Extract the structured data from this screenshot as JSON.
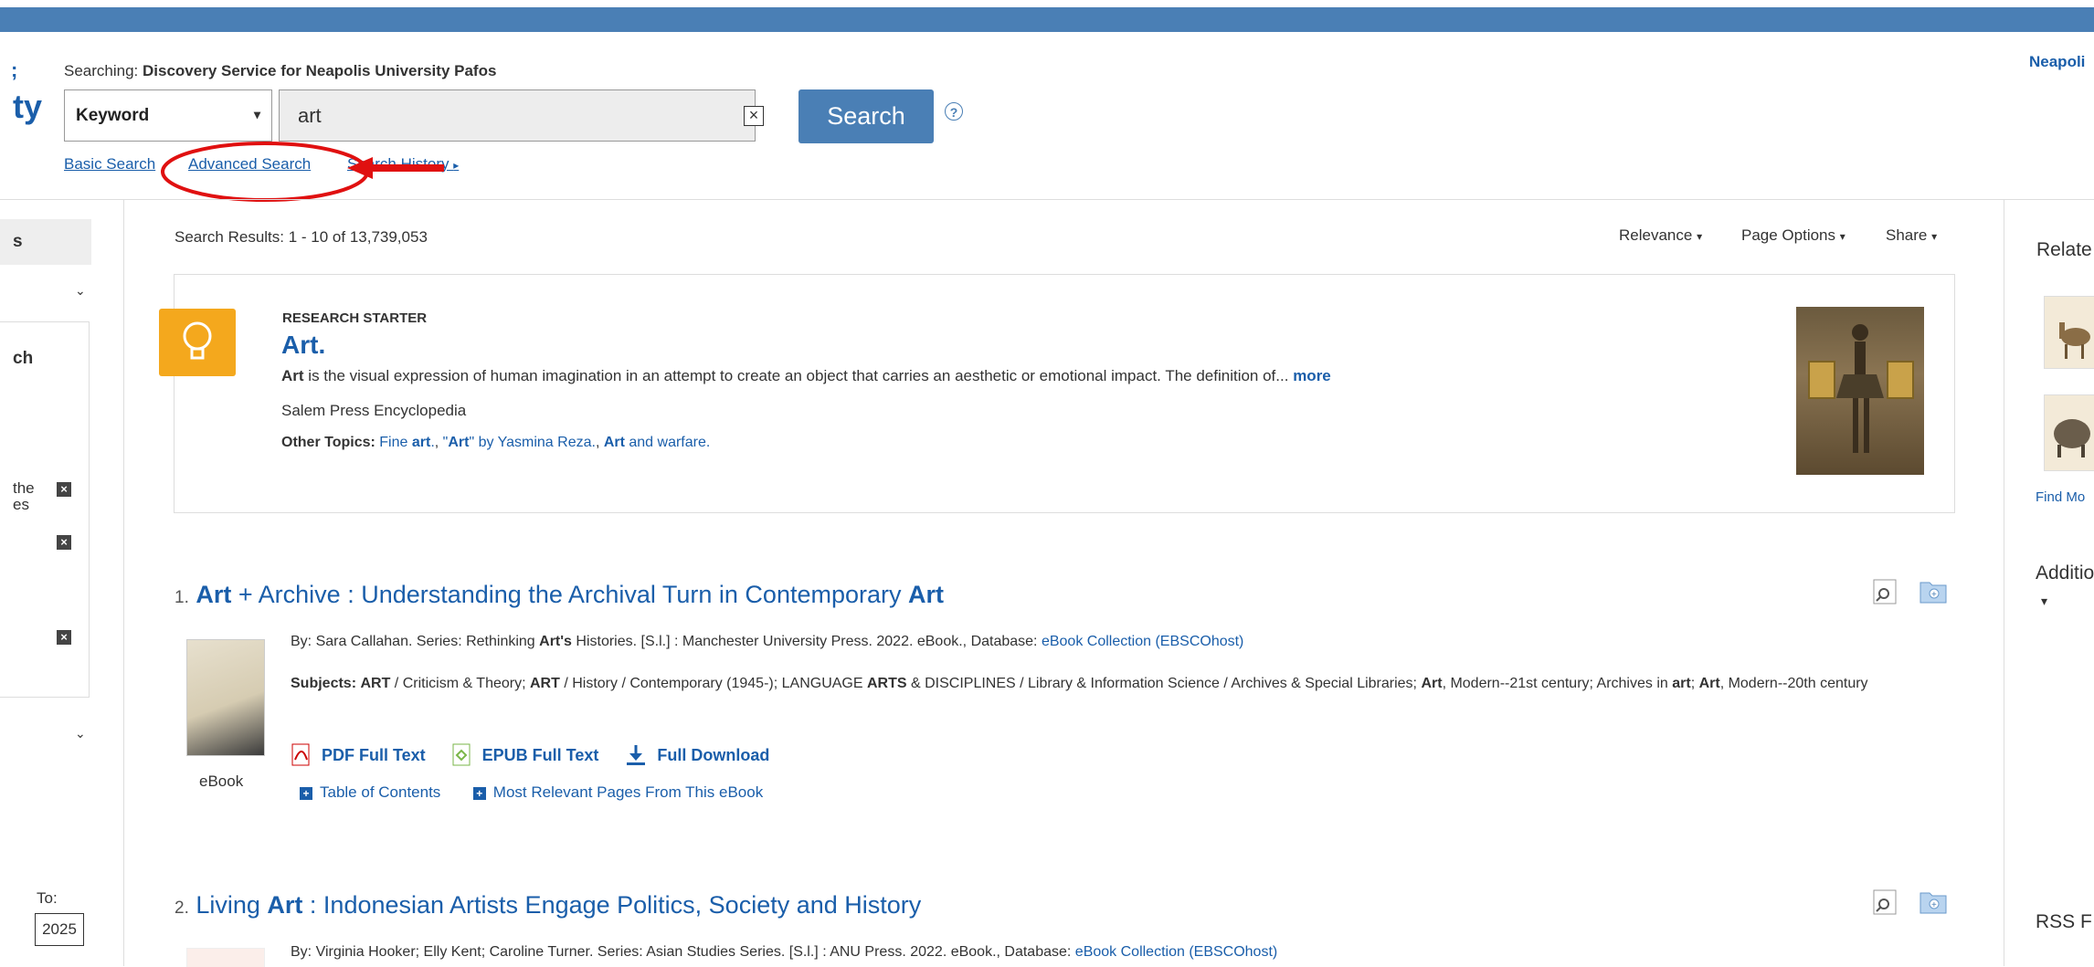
{
  "header": {
    "searching_label": "Searching:",
    "searching_db": "Discovery Service for Neapolis University Pafos",
    "institution_short": "Neapoli",
    "logo_partial": "ty",
    "logo_partial_top": ";"
  },
  "search": {
    "field_select_value": "Keyword",
    "query": "art",
    "button_label": "Search",
    "help_icon": "question-icon"
  },
  "search_links": {
    "basic": "Basic Search",
    "advanced": "Advanced Search",
    "history": "Search History"
  },
  "left_sidebar": {
    "tab_partial": "s",
    "facet_partial": "ch",
    "facet_item_1_line1": "the",
    "facet_item_1_line2": "es",
    "to_label": "To:",
    "to_year": "2025"
  },
  "results_bar": {
    "count_text": "Search Results: 1 - 10 of 13,739,053",
    "sort_label": "Relevance",
    "page_options": "Page Options",
    "share": "Share"
  },
  "research_starter": {
    "label": "RESEARCH STARTER",
    "title": "Art.",
    "snippet_bold": "Art",
    "snippet": " is the visual expression of human imagination in an attempt to create an object that carries an aesthetic or emotional impact. The definition of...",
    "more": "more",
    "source": "Salem Press Encyclopedia",
    "other_topics_label": "Other Topics:",
    "topic_1_a": "Fine ",
    "topic_1_b": "art",
    "topic_1_c": ".",
    "topic_2_a": "\"",
    "topic_2_b": "Art",
    "topic_2_c": "\" by Yasmina Reza.",
    "topic_3_a": "Art",
    "topic_3_b": " and warfare."
  },
  "results": [
    {
      "num": "1.",
      "title_a": "Art",
      "title_b": " + Archive : Understanding the Archival Turn in Contemporary ",
      "title_c": "Art",
      "byline_a": "By: Sara Callahan. Series: Rethinking ",
      "byline_b": "Art's",
      "byline_c": " Histories. [S.l.] : Manchester University Press. 2022. eBook., Database: ",
      "database": "eBook Collection (EBSCOhost)",
      "subjects_label": "Subjects:",
      "subjects_1": "ART",
      "subjects_2": " / Criticism & Theory; ",
      "subjects_3": "ART",
      "subjects_4": " / History / Contemporary (1945-); LANGUAGE ",
      "subjects_5": "ARTS",
      "subjects_6": " & DISCIPLINES / Library & Information Science / Archives & Special Libraries; ",
      "subjects_7": "Art",
      "subjects_8": ", Modern--21st century; Archives in",
      "subjects_9": "art",
      "subjects_10": "; ",
      "subjects_11": "Art",
      "subjects_12": ", Modern--20th century",
      "pdf": "PDF Full Text",
      "epub": "EPUB Full Text",
      "download": "Full Download",
      "type": "eBook",
      "toc": "Table of Contents",
      "relevant": "Most Relevant Pages From This eBook"
    },
    {
      "num": "2.",
      "title_a": "Living ",
      "title_b": "Art",
      "title_c": " : Indonesian Artists Engage Politics, Society and History",
      "byline": "By: Virginia Hooker; Elly Kent; Caroline Turner. Series: Asian Studies Series. [S.l.] : ANU Press. 2022. eBook., Database: ",
      "database": "eBook Collection (EBSCOhost)"
    }
  ],
  "right_sidebar": {
    "related_partial": "Relate",
    "find_more": "Find Mo",
    "additional_partial": "Additio",
    "rss_partial": "RSS F"
  },
  "colors": {
    "topbar": "#4a7fb5",
    "link": "#1a5eaa",
    "annotation": "#e01010",
    "bulb": "#f4a81d"
  }
}
